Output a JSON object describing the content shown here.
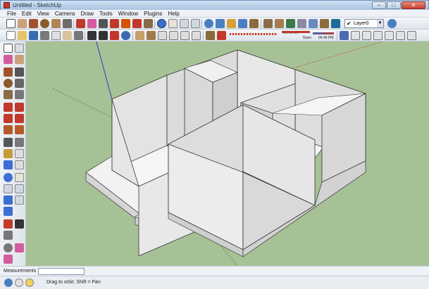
{
  "window": {
    "title": "Untitled - SketchUp",
    "minimize": "–",
    "maximize": "□",
    "close": "✕"
  },
  "menu": [
    "File",
    "Edit",
    "View",
    "Camera",
    "Draw",
    "Tools",
    "Window",
    "Plugins",
    "Help"
  ],
  "layers": {
    "current": "Layer0",
    "check": "✔",
    "arrow": "▼"
  },
  "shadows": {
    "time_start": "06:43 AM",
    "noon": "Noon",
    "time_end": "04:46 PM"
  },
  "measurements": {
    "label": "Measurements",
    "value": ""
  },
  "status": {
    "hint": "Drag to orbit.  Shift = Pan"
  },
  "colors": {
    "viewport_background": "#a6c195",
    "axis_blue": "#2a3fbf",
    "axis_red": "#c0392b",
    "axis_green": "#2c7a2c",
    "wall_face": "#e9e9ea",
    "floor_face": "#f5f5f5"
  }
}
